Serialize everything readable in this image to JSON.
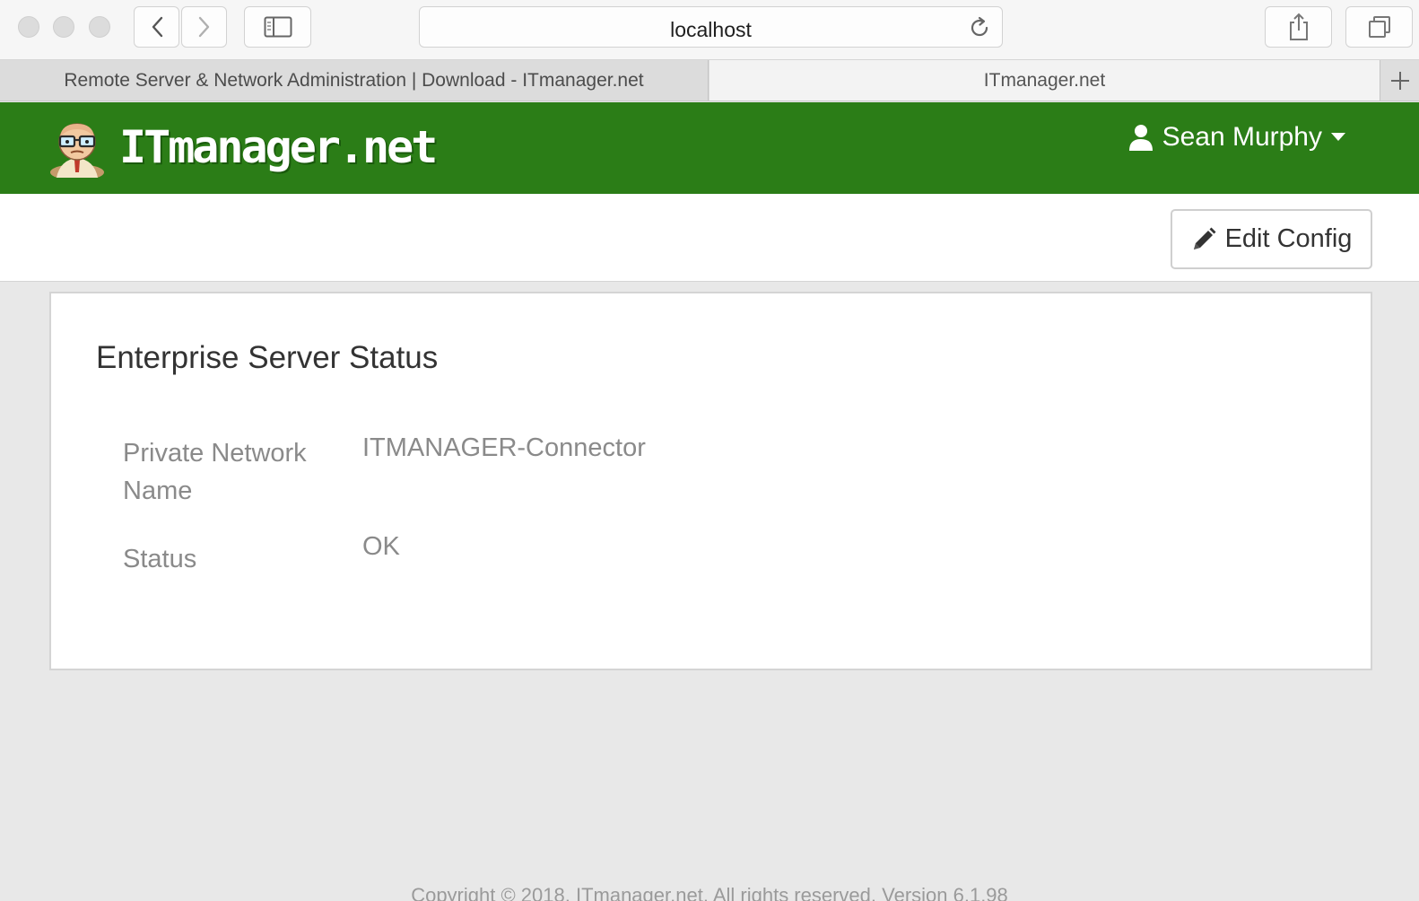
{
  "browser": {
    "address": "localhost",
    "tabs": [
      {
        "title": "Remote Server & Network Administration | Download - ITmanager.net",
        "active": false
      },
      {
        "title": "ITmanager.net",
        "active": true
      }
    ]
  },
  "header": {
    "brand": "ITmanager.net",
    "user_name": "Sean Murphy",
    "brand_color": "#2b7d17"
  },
  "toolbar": {
    "edit_config_label": "Edit Config"
  },
  "panel": {
    "title": "Enterprise Server Status",
    "fields": [
      {
        "label": "Private Network Name",
        "value": "ITMANAGER-Connector"
      },
      {
        "label": "Status",
        "value": "OK"
      }
    ]
  },
  "footer": {
    "text": "Copyright © 2018, ITmanager.net. All rights reserved. Version 6.1.98"
  }
}
